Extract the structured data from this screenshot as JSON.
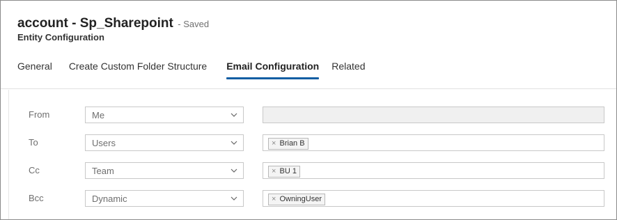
{
  "header": {
    "title": "account - Sp_Sharepoint",
    "saved": "- Saved",
    "subtitle": "Entity Configuration"
  },
  "tabs": [
    {
      "label": "General",
      "active": false
    },
    {
      "label": "Create Custom Folder Structure",
      "active": false
    },
    {
      "label": "Email Configuration",
      "active": true
    },
    {
      "label": "Related",
      "active": false
    }
  ],
  "form": {
    "rows": [
      {
        "label": "From",
        "select": "Me",
        "tag": ""
      },
      {
        "label": "To",
        "select": "Users",
        "tag": "Brian B"
      },
      {
        "label": "Cc",
        "select": "Team",
        "tag": "BU 1"
      },
      {
        "label": "Bcc",
        "select": "Dynamic",
        "tag": "OwningUser"
      }
    ],
    "remove_glyph": "×"
  },
  "colors": {
    "accent": "#115ea3",
    "label": "#6e6e6e",
    "border": "#c8c8c8"
  },
  "icons": {
    "dropdown": "chevron-down-icon",
    "remove": "remove-tag-icon"
  }
}
